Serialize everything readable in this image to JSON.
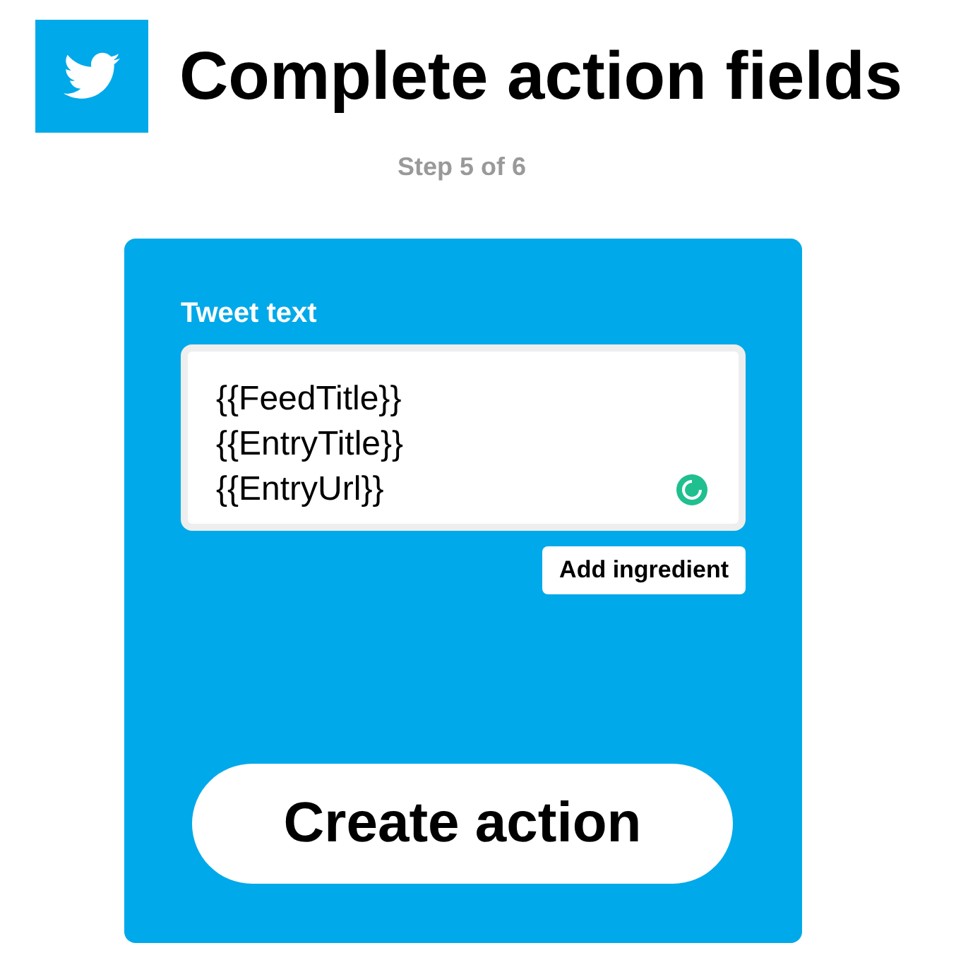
{
  "header": {
    "title": "Complete action fields",
    "step": "Step 5 of 6"
  },
  "form": {
    "field_label": "Tweet text",
    "value": "{{FeedTitle}}\n{{EntryTitle}}\n{{EntryUrl}}",
    "ingredient_button": "Add ingredient",
    "submit_button": "Create action"
  }
}
